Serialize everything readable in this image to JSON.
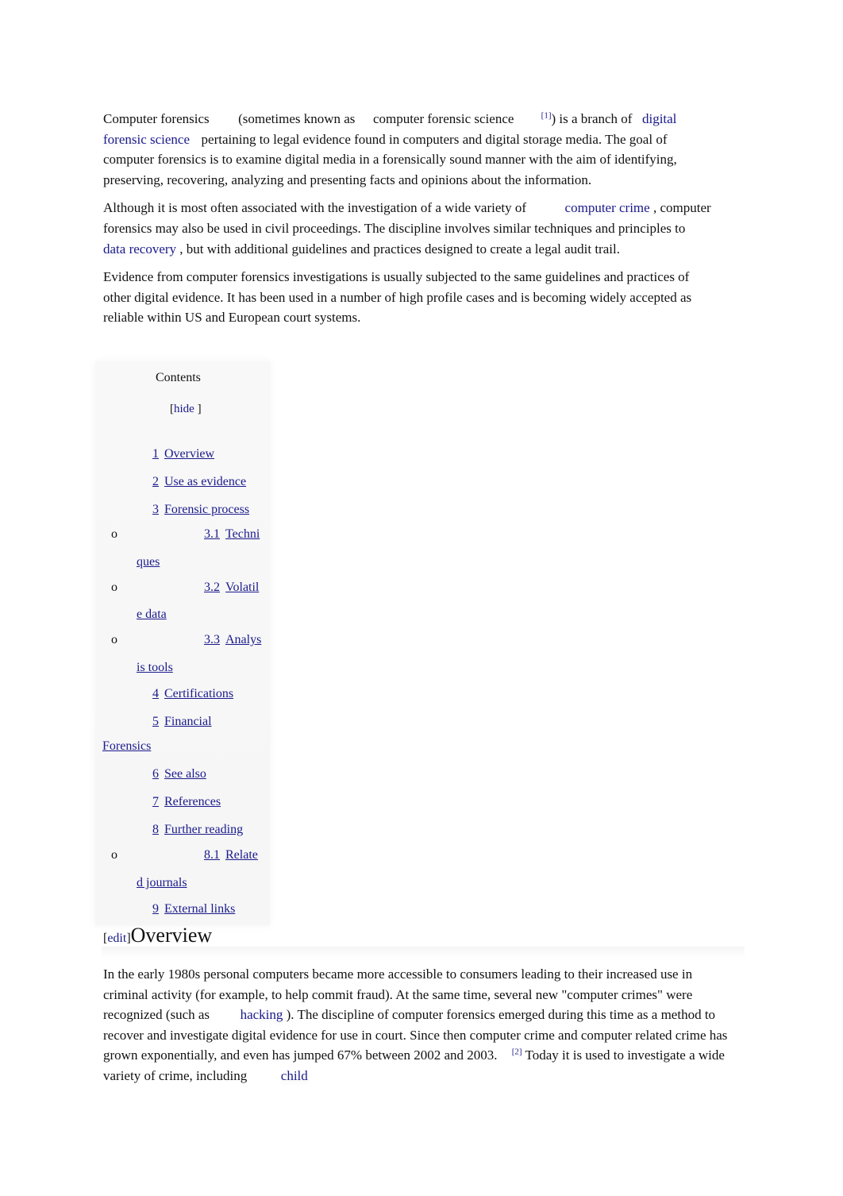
{
  "intro": {
    "p1": {
      "t1": "Computer forensics",
      "t2": "(sometimes known as",
      "t3": "computer forensic science",
      "ref": "[1]",
      "t4": ") is a branch of",
      "link1a": "digital",
      "link1b": "forensic science",
      "t5": "pertaining to legal evidence found in computers and digital storage media. The goal of computer forensics is to examine digital media in a forensically sound manner with the aim of identifying, preserving, recovering, analyzing and presenting facts and opinions about the information."
    },
    "p2": {
      "t1": "Although it is most often associated with the investigation of a wide variety of",
      "link1": "computer crime",
      "t2": ", computer forensics may also be used in civil proceedings. The discipline involves similar techniques and principles to",
      "link2": "data recovery",
      "t3": ", but with additional guidelines and practices designed to create a legal audit trail."
    },
    "p3": "Evidence from computer forensics investigations is usually subjected to the same guidelines and practices of other digital evidence. It has been used in a number of high profile cases and is becoming widely accepted as reliable within US and European court systems."
  },
  "toc": {
    "title": "Contents",
    "hide_open": "[",
    "hide_label": "hide",
    "hide_close": "]",
    "bullet": "o",
    "items": [
      {
        "num": "1",
        "label": "Overview"
      },
      {
        "num": "2",
        "label": "Use as evidence"
      },
      {
        "num": "3",
        "label": "Forensic process"
      },
      {
        "num": "3.1",
        "label": "Techni",
        "wrap": "ques"
      },
      {
        "num": "3.2",
        "label": "Volatil",
        "wrap": "e data"
      },
      {
        "num": "3.3",
        "label": "Analys",
        "wrap": "is tools"
      },
      {
        "num": "4",
        "label": "Certifications"
      },
      {
        "num": "5",
        "label": "Financial",
        "wrap": "Forensics"
      },
      {
        "num": "6",
        "label": "See also"
      },
      {
        "num": "7",
        "label": "References"
      },
      {
        "num": "8",
        "label": "Further reading"
      },
      {
        "num": "8.1",
        "label": "Relate",
        "wrap": "d journals"
      },
      {
        "num": "9",
        "label": "External links"
      }
    ]
  },
  "overview": {
    "edit_open": "[",
    "edit_label": "edit",
    "edit_close": "]",
    "heading": "Overview",
    "p": {
      "t1": "In the early 1980s personal computers became more accessible to consumers leading to their increased use in criminal activity (for example, to help commit fraud). At the same time, several new \"computer crimes\" were recognized (such as",
      "link1": "hacking",
      "t2": "). The discipline of computer forensics emerged during this time as a method to recover and investigate digital evidence for use in court. Since then computer crime and computer related crime has grown exponentially, and even has jumped 67% between 2002 and 2003.",
      "ref": "[2]",
      "t3": "Today it is used to investigate a wide variety of crime, including",
      "link2": "child"
    }
  }
}
